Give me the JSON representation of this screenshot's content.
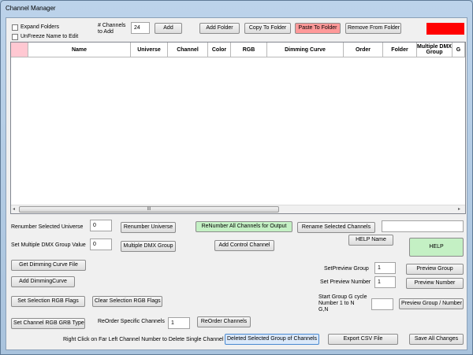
{
  "window": {
    "title": "Channel Manager"
  },
  "options": {
    "expand_folders": "Expand Folders",
    "unfreeze": "UnFreeze Name to Edit"
  },
  "toolbar": {
    "channels_to_add_label": "# Channels\nto Add",
    "channels_to_add_value": "24",
    "add": "Add",
    "add_folder": "Add Folder",
    "copy_to_folder": "Copy To Folder",
    "paste_to_folder": "Paste To Folder",
    "remove_from_folder": "Remove From Folder"
  },
  "colors": {
    "paste_button": "#ff9999",
    "status_box": "#ff0000",
    "renumber_all": "#c4f0c4",
    "help": "#c4f0c4",
    "deleted_group": "#dbe9fa"
  },
  "grid": {
    "columns": [
      "Name",
      "Universe",
      "Channel",
      "Color",
      "RGB",
      "Dimming Curve",
      "Order",
      "Folder",
      "Multiple DMX Group",
      "G"
    ],
    "scroll_grip": "III"
  },
  "controls": {
    "renumber_universe_label": "Renumber Selected Universe",
    "renumber_universe_value": "0",
    "renumber_universe": "Renumber Universe",
    "renumber_all": "ReNumber All Channels for Output",
    "rename_selected": "Rename Selected Channels",
    "rename_value": "",
    "help_name": "HELP Name",
    "help": "HELP",
    "dmx_group_label": "Set Multiple DMX Group Value",
    "dmx_group_value": "0",
    "multiple_dmx_group": "Multiple DMX Group",
    "add_control_channel": "Add Control Channel",
    "get_dimming_curve_file": "Get Dimming Curve File",
    "add_dimming_curve": "Add DimmingCurve",
    "set_preview_group_label": "SetPreview Group",
    "set_preview_group_value": "1",
    "preview_group": "Preview Group",
    "set_preview_number_label": "Set Preview Number",
    "set_preview_number_value": "1",
    "preview_number": "Preview Number",
    "set_selection_rgb": "Set Selection RGB Flags",
    "clear_selection_rgb": "Clear Selection RGB Flags",
    "start_group_label": "Start Group G cycle\nNumber 1 to N\nG,N",
    "start_group_value": "",
    "preview_group_number": "Preview Group / Number",
    "set_channel_rgb_grb": "Set Channel RGB GRB Type",
    "reorder_label": "ReOrder Specific Channels",
    "reorder_value": "1",
    "reorder_channels": "ReOrder Channels",
    "right_click_hint": "Right Click on Far Left Channel Number to Delete Single Channel",
    "deleted_selected_group": "Deleted Selected Group of Channels",
    "export_csv": "Export CSV File",
    "save_all": "Save All Changes"
  }
}
